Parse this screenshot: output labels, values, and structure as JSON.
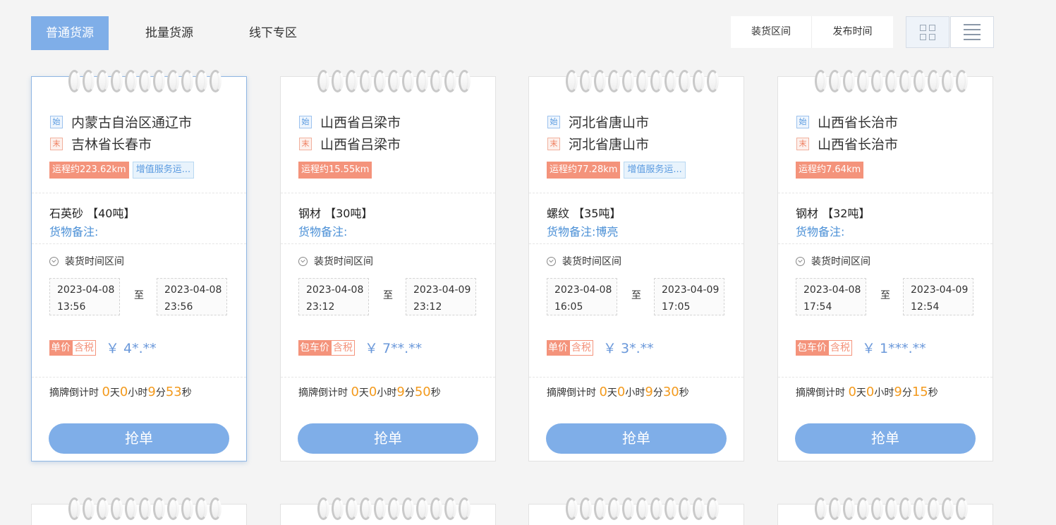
{
  "tabs": [
    {
      "label": "普通货源"
    },
    {
      "label": "批量货源"
    },
    {
      "label": "线下专区"
    }
  ],
  "sort": {
    "load_range": "装货区间",
    "publish_time": "发布时间"
  },
  "view_icons": {
    "grid": "grid-view-icon",
    "list": "list-view-icon"
  },
  "colors": {
    "accent": "#7faee8",
    "distance_badge": "#f4937b",
    "countdown_number": "#f39a1d",
    "price": "#6a98da"
  },
  "labels": {
    "start_tag": "始",
    "end_tag": "末",
    "load_time_range": "装货时间区间",
    "to": "至",
    "tax_included": "含税",
    "countdown_prefix": "摘牌倒计时",
    "day": "天",
    "hour": "小时",
    "minute": "分",
    "second": "秒",
    "grab_button": "抢单"
  },
  "cards": [
    {
      "origin": "内蒙古自治区通辽市",
      "destination": "吉林省长春市",
      "distance": "运程约223.62km",
      "service": "增值服务运...",
      "cargo": "石英砂 【40吨】",
      "remark": "货物备注:",
      "start_date": "2023-04-08",
      "start_time": "13:56",
      "end_date": "2023-04-08",
      "end_time": "23:56",
      "price_type": "单价",
      "price": "￥ 4*.**",
      "countdown": {
        "d": "0",
        "h": "0",
        "m": "9",
        "s": "53"
      }
    },
    {
      "origin": "山西省吕梁市",
      "destination": "山西省吕梁市",
      "distance": "运程约15.55km",
      "service": "",
      "cargo": "钢材 【30吨】",
      "remark": "货物备注:",
      "start_date": "2023-04-08",
      "start_time": "23:12",
      "end_date": "2023-04-09",
      "end_time": "23:12",
      "price_type": "包车价",
      "price": "￥ 7**.**",
      "countdown": {
        "d": "0",
        "h": "0",
        "m": "9",
        "s": "50"
      }
    },
    {
      "origin": "河北省唐山市",
      "destination": "河北省唐山市",
      "distance": "运程约77.28km",
      "service": "增值服务运...",
      "cargo": "螺纹 【35吨】",
      "remark": "货物备注:博亮",
      "start_date": "2023-04-08",
      "start_time": "16:05",
      "end_date": "2023-04-09",
      "end_time": "17:05",
      "price_type": "单价",
      "price": "￥ 3*.**",
      "countdown": {
        "d": "0",
        "h": "0",
        "m": "9",
        "s": "30"
      }
    },
    {
      "origin": "山西省长治市",
      "destination": "山西省长治市",
      "distance": "运程约7.64km",
      "service": "",
      "cargo": "钢材 【32吨】",
      "remark": "货物备注:",
      "start_date": "2023-04-08",
      "start_time": "17:54",
      "end_date": "2023-04-09",
      "end_time": "12:54",
      "price_type": "包车价",
      "price": "￥ 1***.**",
      "countdown": {
        "d": "0",
        "h": "0",
        "m": "9",
        "s": "15"
      }
    }
  ]
}
